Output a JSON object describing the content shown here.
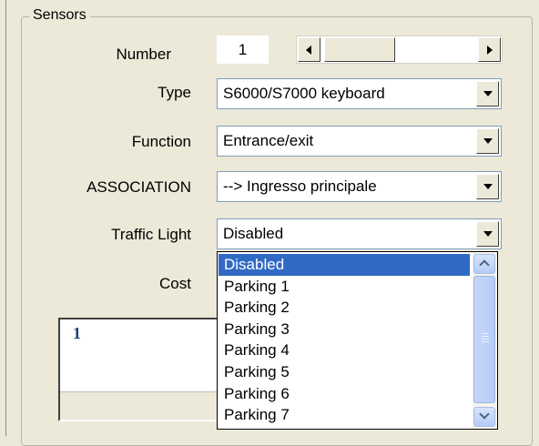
{
  "group": {
    "title": "Sensors"
  },
  "number": {
    "label": "Number",
    "value": "1"
  },
  "type": {
    "label": "Type",
    "value": "S6000/S7000 keyboard"
  },
  "function": {
    "label": "Function",
    "value": "Entrance/exit"
  },
  "association": {
    "label": "ASSOCIATION",
    "value": "--> Ingresso principale"
  },
  "traffic_light": {
    "label": "Traffic Light",
    "value": "Disabled",
    "options": [
      "Disabled",
      "Parking 1",
      "Parking 2",
      "Parking 3",
      "Parking 4",
      "Parking 5",
      "Parking 6",
      "Parking 7"
    ],
    "selected_index": 0
  },
  "cost": {
    "label": "Cost"
  },
  "list": {
    "value": "1"
  },
  "icons": {
    "scroll_left": "triangle-left-icon",
    "scroll_right": "triangle-right-icon",
    "dropdown_arrow": "triangle-down-icon",
    "scroll_up": "chevron-up-icon",
    "scroll_down": "chevron-down-icon"
  },
  "colors": {
    "selection": "#316ac5",
    "list_text": "#1f3d7a",
    "background": "#ece9d8"
  }
}
